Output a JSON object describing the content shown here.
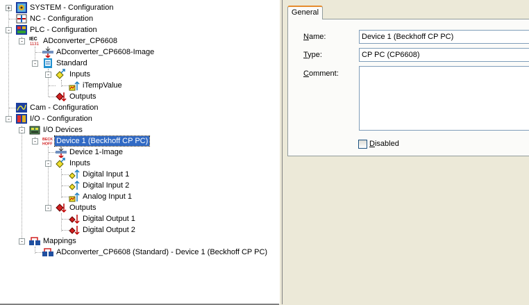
{
  "tree": {
    "nodes": [
      {
        "label": "SYSTEM - Configuration",
        "icon": "system-config-icon",
        "expander": "+"
      },
      {
        "label": "NC - Configuration",
        "icon": "nc-config-icon",
        "expander": ""
      },
      {
        "label": "PLC - Configuration",
        "icon": "plc-config-icon",
        "expander": "-"
      },
      {
        "label": "ADconverter_CP6608",
        "icon": "iec-project-icon",
        "expander": "-"
      },
      {
        "label": "ADconverter_CP6608-Image",
        "icon": "process-image-icon",
        "expander": ""
      },
      {
        "label": "Standard",
        "icon": "task-icon",
        "expander": "-"
      },
      {
        "label": "Inputs",
        "icon": "inputs-folder-icon",
        "expander": "-"
      },
      {
        "label": "iTempValue",
        "icon": "analog-input-var-icon",
        "expander": ""
      },
      {
        "label": "Outputs",
        "icon": "outputs-folder-icon",
        "expander": ""
      },
      {
        "label": "Cam - Configuration",
        "icon": "cam-config-icon",
        "expander": ""
      },
      {
        "label": "I/O - Configuration",
        "icon": "io-config-icon",
        "expander": "-"
      },
      {
        "label": "I/O Devices",
        "icon": "io-devices-icon",
        "expander": "-"
      },
      {
        "label": "Device 1 (Beckhoff CP PC)",
        "icon": "beckhoff-device-icon",
        "expander": "-"
      },
      {
        "label": "Device 1-Image",
        "icon": "process-image-icon",
        "expander": ""
      },
      {
        "label": "Inputs",
        "icon": "inputs-folder-icon",
        "expander": "-"
      },
      {
        "label": "Digital Input 1",
        "icon": "digital-input-icon",
        "expander": ""
      },
      {
        "label": "Digital Input 2",
        "icon": "digital-input-icon",
        "expander": ""
      },
      {
        "label": "Analog Input 1",
        "icon": "analog-input-var-icon",
        "expander": ""
      },
      {
        "label": "Outputs",
        "icon": "outputs-folder-icon",
        "expander": "-"
      },
      {
        "label": "Digital Output 1",
        "icon": "digital-output-icon",
        "expander": ""
      },
      {
        "label": "Digital Output 2",
        "icon": "digital-output-icon",
        "expander": ""
      },
      {
        "label": "Mappings",
        "icon": "mappings-icon",
        "expander": "-"
      },
      {
        "label": "ADconverter_CP6608 (Standard) - Device 1 (Beckhoff CP PC)",
        "icon": "mapping-icon",
        "expander": ""
      }
    ],
    "beckhoff_logo_text": "BECK HOFF"
  },
  "properties": {
    "tab_label": "General",
    "name_label": "Name:",
    "name_value": "Device 1 (Beckhoff CP PC)",
    "type_label": "Type:",
    "type_value": "CP PC (CP6608)",
    "comment_label": "Comment:",
    "comment_value": "",
    "disabled_label": "Disabled"
  },
  "colors": {
    "selection": "#316ac5",
    "tab_accent": "#e68b2c",
    "panel_bg": "#ece9d8"
  }
}
